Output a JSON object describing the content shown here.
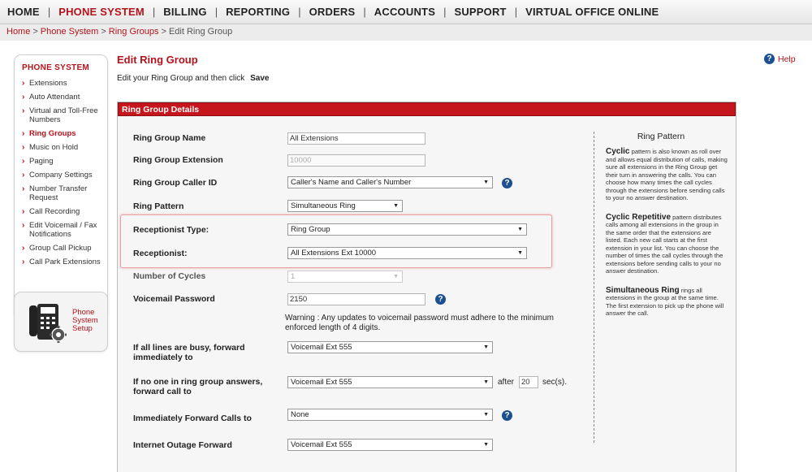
{
  "nav": [
    "HOME",
    "PHONE SYSTEM",
    "BILLING",
    "REPORTING",
    "ORDERS",
    "ACCOUNTS",
    "SUPPORT",
    "VIRTUAL OFFICE ONLINE"
  ],
  "breadcrumb": {
    "home": "Home",
    "phone_system": "Phone System",
    "ring_groups": "Ring Groups",
    "current": "Edit Ring Group"
  },
  "sidebar": {
    "heading": "PHONE SYSTEM",
    "items": [
      "Extensions",
      "Auto Attendant",
      "Virtual and Toll-Free Numbers",
      "Ring Groups",
      "Music on Hold",
      "Paging",
      "Company Settings",
      "Number Transfer Request",
      "Call Recording",
      "Edit Voicemail / Fax Notifications",
      "Group Call Pickup",
      "Call Park Extensions"
    ],
    "setup_label_1": "Phone",
    "setup_label_2": "System",
    "setup_label_3": "Setup"
  },
  "main": {
    "title": "Edit Ring Group",
    "intro": "Edit your Ring Group and then click",
    "intro_save": "Save",
    "help": "Help",
    "panel_title": "Ring Group Details"
  },
  "form": {
    "name_label": "Ring Group Name",
    "name_value": "All Extensions",
    "ext_label": "Ring Group Extension",
    "ext_value": "10000",
    "callerid_label": "Ring Group Caller ID",
    "callerid_value": "Caller's Name and Caller's Number",
    "pattern_label": "Ring Pattern",
    "pattern_value": "Simultaneous Ring",
    "rtype_label": "Receptionist Type:",
    "rtype_value": "Ring Group",
    "recep_label": "Receptionist:",
    "recep_value": "All Extensions Ext 10000",
    "cycles_label": "Number of Cycles",
    "cycles_value": "1",
    "vm_label": "Voicemail Password",
    "vm_value": "2150",
    "warning_1": "Warning : Any updates to voicemail password must adhere to the minimum",
    "warning_2": "enforced length of 4 digits.",
    "busy_label_1": "If all lines are busy, forward",
    "busy_label_2": "immediately to",
    "busy_value": "Voicemail Ext 555",
    "noans_label_1": "If no one in ring group answers,",
    "noans_label_2": "forward call to",
    "noans_value": "Voicemail Ext 555",
    "after_label": "after",
    "after_value": "20",
    "secs_label": "sec(s).",
    "immed_label": "Immediately Forward Calls to",
    "immed_value": "None",
    "outage_label": "Internet Outage Forward",
    "outage_value": "Voicemail Ext 555"
  },
  "pattern_help": {
    "heading": "Ring Pattern",
    "cyclic_title": "Cyclic",
    "cyclic_text": "pattern is also known as roll over and allows equal distribution of calls, making sure all extensions in the Ring Group get their turn in answering the calls. You can choose how many times the call cycles through the extensions before sending calls to your no answer destination.",
    "cyclic_rep_title": "Cyclic Repetitive",
    "cyclic_rep_text": "pattern distributes calls among all extensions in the group in the same order that the extensions are listed. Each new call starts at the first extension in your list. You can choose the number of times the call cycles through the extensions before sending calls to your no answer destination.",
    "sim_title": "Simultaneous Ring",
    "sim_text": "rings all extensions in the group at the same time. The first extension to pick up the phone will answer the call."
  },
  "colors": {
    "brand_red": "#b3131b",
    "panel_header": "#c4161c",
    "help_icon": "#1c4f92"
  }
}
